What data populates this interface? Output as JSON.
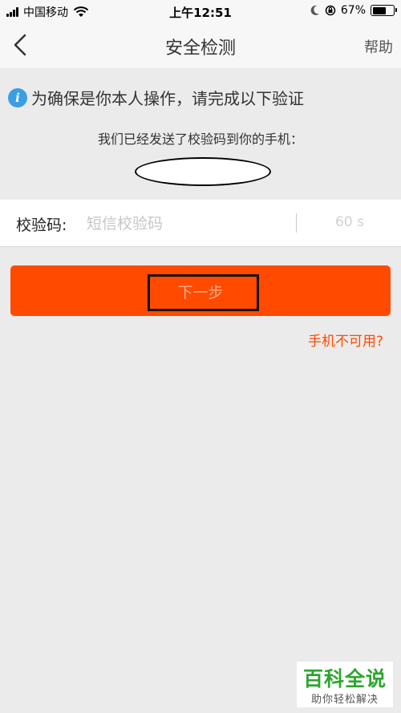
{
  "status_bar": {
    "carrier": "中国移动",
    "time": "上午12:51",
    "battery": "67%",
    "battery_level": 0.67,
    "icons": [
      "signal-icon",
      "wifi-icon",
      "moon-icon",
      "rotation-lock-icon",
      "battery-icon"
    ]
  },
  "nav": {
    "title": "安全检测",
    "help": "帮助",
    "back_icon": "chevron-left-icon"
  },
  "info": {
    "icon": "info-icon",
    "icon_glyph": "i",
    "notice": "为确保是你本人操作，请完成以下验证",
    "sent_message": "我们已经发送了校验码到你的手机："
  },
  "code_field": {
    "label": "校验码:",
    "placeholder": "短信校验码",
    "countdown": "60 s"
  },
  "actions": {
    "next_label": "下一步",
    "phone_unavailable": "手机不可用?"
  },
  "colors": {
    "accent": "#ff4a00",
    "info_blue": "#3a9ee4",
    "background": "#ebebeb"
  },
  "watermark": {
    "title": "百科全说",
    "subtitle": "助你轻松解决"
  }
}
